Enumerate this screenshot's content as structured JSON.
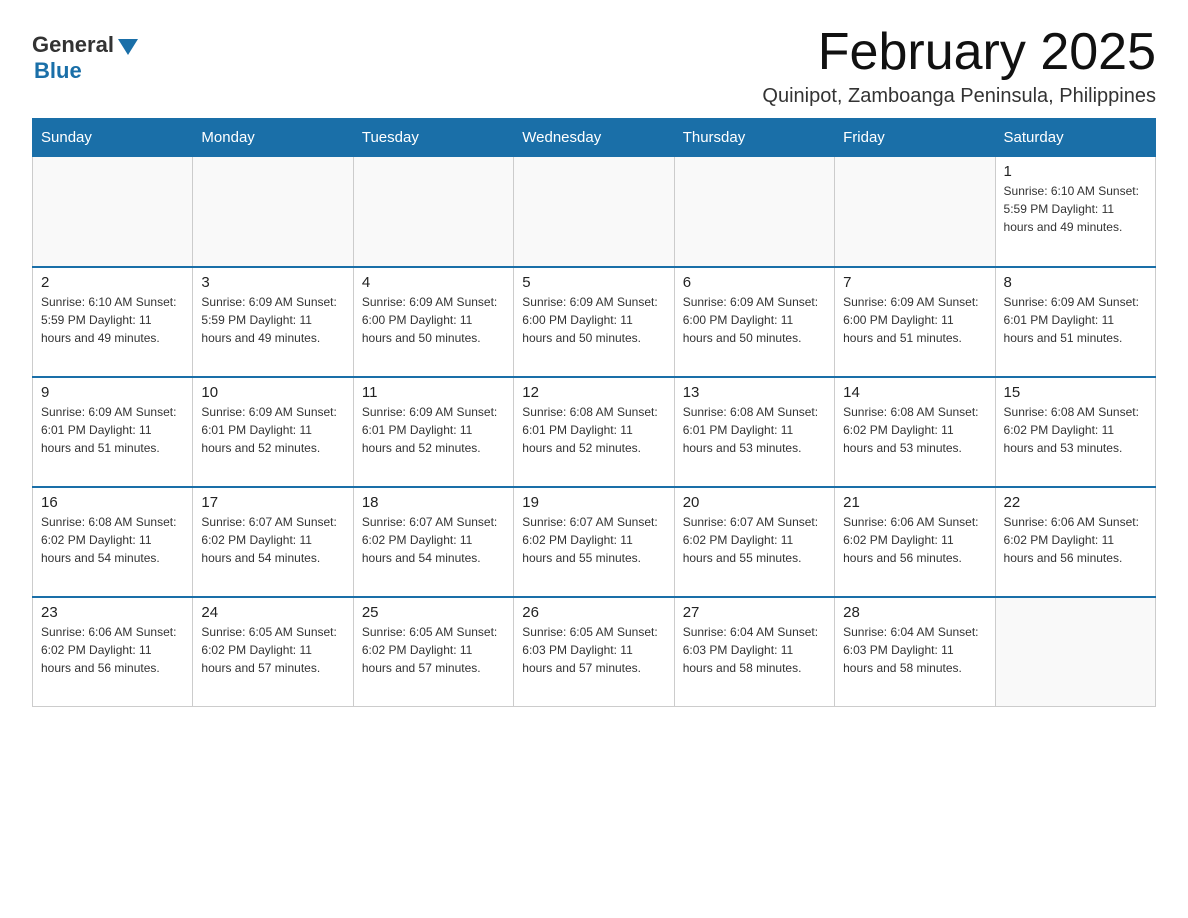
{
  "logo": {
    "general": "General",
    "blue": "Blue"
  },
  "title": "February 2025",
  "subtitle": "Quinipot, Zamboanga Peninsula, Philippines",
  "days_of_week": [
    "Sunday",
    "Monday",
    "Tuesday",
    "Wednesday",
    "Thursday",
    "Friday",
    "Saturday"
  ],
  "weeks": [
    [
      {
        "day": "",
        "info": ""
      },
      {
        "day": "",
        "info": ""
      },
      {
        "day": "",
        "info": ""
      },
      {
        "day": "",
        "info": ""
      },
      {
        "day": "",
        "info": ""
      },
      {
        "day": "",
        "info": ""
      },
      {
        "day": "1",
        "info": "Sunrise: 6:10 AM\nSunset: 5:59 PM\nDaylight: 11 hours\nand 49 minutes."
      }
    ],
    [
      {
        "day": "2",
        "info": "Sunrise: 6:10 AM\nSunset: 5:59 PM\nDaylight: 11 hours\nand 49 minutes."
      },
      {
        "day": "3",
        "info": "Sunrise: 6:09 AM\nSunset: 5:59 PM\nDaylight: 11 hours\nand 49 minutes."
      },
      {
        "day": "4",
        "info": "Sunrise: 6:09 AM\nSunset: 6:00 PM\nDaylight: 11 hours\nand 50 minutes."
      },
      {
        "day": "5",
        "info": "Sunrise: 6:09 AM\nSunset: 6:00 PM\nDaylight: 11 hours\nand 50 minutes."
      },
      {
        "day": "6",
        "info": "Sunrise: 6:09 AM\nSunset: 6:00 PM\nDaylight: 11 hours\nand 50 minutes."
      },
      {
        "day": "7",
        "info": "Sunrise: 6:09 AM\nSunset: 6:00 PM\nDaylight: 11 hours\nand 51 minutes."
      },
      {
        "day": "8",
        "info": "Sunrise: 6:09 AM\nSunset: 6:01 PM\nDaylight: 11 hours\nand 51 minutes."
      }
    ],
    [
      {
        "day": "9",
        "info": "Sunrise: 6:09 AM\nSunset: 6:01 PM\nDaylight: 11 hours\nand 51 minutes."
      },
      {
        "day": "10",
        "info": "Sunrise: 6:09 AM\nSunset: 6:01 PM\nDaylight: 11 hours\nand 52 minutes."
      },
      {
        "day": "11",
        "info": "Sunrise: 6:09 AM\nSunset: 6:01 PM\nDaylight: 11 hours\nand 52 minutes."
      },
      {
        "day": "12",
        "info": "Sunrise: 6:08 AM\nSunset: 6:01 PM\nDaylight: 11 hours\nand 52 minutes."
      },
      {
        "day": "13",
        "info": "Sunrise: 6:08 AM\nSunset: 6:01 PM\nDaylight: 11 hours\nand 53 minutes."
      },
      {
        "day": "14",
        "info": "Sunrise: 6:08 AM\nSunset: 6:02 PM\nDaylight: 11 hours\nand 53 minutes."
      },
      {
        "day": "15",
        "info": "Sunrise: 6:08 AM\nSunset: 6:02 PM\nDaylight: 11 hours\nand 53 minutes."
      }
    ],
    [
      {
        "day": "16",
        "info": "Sunrise: 6:08 AM\nSunset: 6:02 PM\nDaylight: 11 hours\nand 54 minutes."
      },
      {
        "day": "17",
        "info": "Sunrise: 6:07 AM\nSunset: 6:02 PM\nDaylight: 11 hours\nand 54 minutes."
      },
      {
        "day": "18",
        "info": "Sunrise: 6:07 AM\nSunset: 6:02 PM\nDaylight: 11 hours\nand 54 minutes."
      },
      {
        "day": "19",
        "info": "Sunrise: 6:07 AM\nSunset: 6:02 PM\nDaylight: 11 hours\nand 55 minutes."
      },
      {
        "day": "20",
        "info": "Sunrise: 6:07 AM\nSunset: 6:02 PM\nDaylight: 11 hours\nand 55 minutes."
      },
      {
        "day": "21",
        "info": "Sunrise: 6:06 AM\nSunset: 6:02 PM\nDaylight: 11 hours\nand 56 minutes."
      },
      {
        "day": "22",
        "info": "Sunrise: 6:06 AM\nSunset: 6:02 PM\nDaylight: 11 hours\nand 56 minutes."
      }
    ],
    [
      {
        "day": "23",
        "info": "Sunrise: 6:06 AM\nSunset: 6:02 PM\nDaylight: 11 hours\nand 56 minutes."
      },
      {
        "day": "24",
        "info": "Sunrise: 6:05 AM\nSunset: 6:02 PM\nDaylight: 11 hours\nand 57 minutes."
      },
      {
        "day": "25",
        "info": "Sunrise: 6:05 AM\nSunset: 6:02 PM\nDaylight: 11 hours\nand 57 minutes."
      },
      {
        "day": "26",
        "info": "Sunrise: 6:05 AM\nSunset: 6:03 PM\nDaylight: 11 hours\nand 57 minutes."
      },
      {
        "day": "27",
        "info": "Sunrise: 6:04 AM\nSunset: 6:03 PM\nDaylight: 11 hours\nand 58 minutes."
      },
      {
        "day": "28",
        "info": "Sunrise: 6:04 AM\nSunset: 6:03 PM\nDaylight: 11 hours\nand 58 minutes."
      },
      {
        "day": "",
        "info": ""
      }
    ]
  ]
}
